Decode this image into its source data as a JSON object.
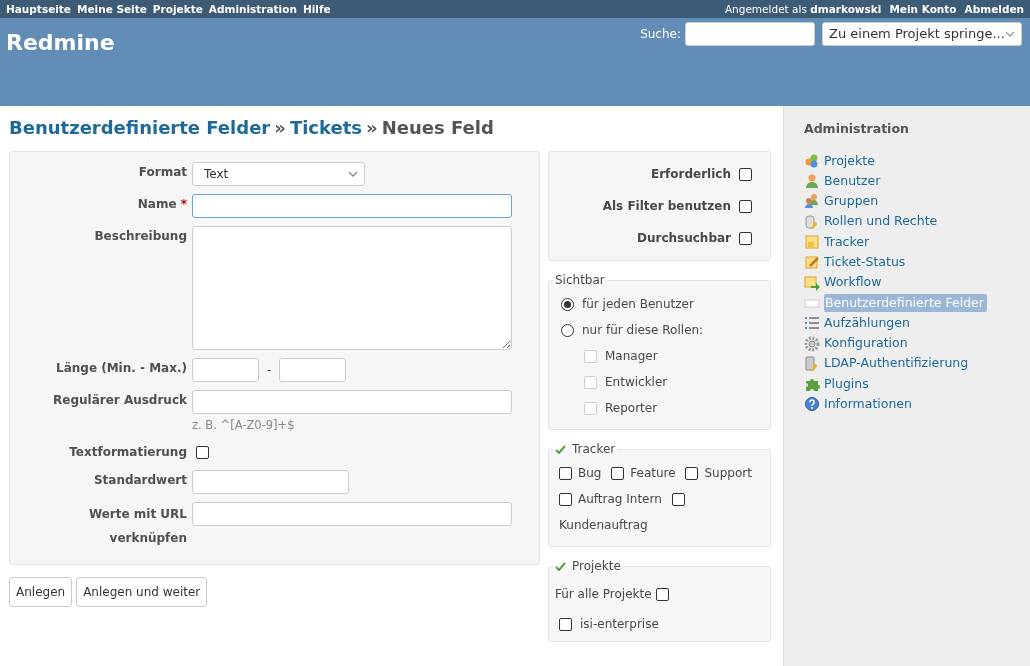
{
  "top_menu": {
    "links": [
      "Hauptseite",
      "Meine Seite",
      "Projekte",
      "Administration",
      "Hilfe"
    ],
    "logged_in_label": "Angemeldet als",
    "user": "dmarkowski",
    "account_links": [
      "Mein Konto",
      "Abmelden"
    ]
  },
  "header": {
    "title": "Redmine",
    "search_label": "Suche:",
    "jump": {
      "value": "Zu einem Projekt springe..."
    }
  },
  "breadcrumb": [
    {
      "text": "Benutzerdefinierte Felder",
      "kind": "link"
    },
    {
      "text": "»",
      "kind": "sep"
    },
    {
      "text": "Tickets",
      "kind": "link"
    },
    {
      "text": "»",
      "kind": "sep"
    },
    {
      "text": "Neues Feld",
      "kind": "current"
    }
  ],
  "form": {
    "fields": [
      {
        "label": "Format",
        "kind": "select",
        "value": "Text"
      },
      {
        "label": "Name",
        "kind": "text",
        "required": true,
        "required_mark": "*",
        "focused": true
      },
      {
        "label": "Beschreibung",
        "kind": "textarea"
      },
      {
        "label": "Länge (Min. - Max.)",
        "kind": "range",
        "separator": "-"
      },
      {
        "label": "Regulärer Ausdruck",
        "kind": "text",
        "hint": "z. B. ^[A-Z0-9]+$"
      },
      {
        "label": "Textformatierung",
        "kind": "checkbox",
        "checked": false
      },
      {
        "label": "Standardwert",
        "kind": "shorttext"
      },
      {
        "label": "Werte mit URL verknüpfen",
        "kind": "text"
      }
    ]
  },
  "flags": [
    {
      "label": "Erforderlich",
      "checked": false
    },
    {
      "label": "Als Filter benutzen",
      "checked": false
    },
    {
      "label": "Durchsuchbar",
      "checked": false
    }
  ],
  "visible": {
    "legend": "Sichtbar",
    "options": [
      {
        "label": "für jeden Benutzer",
        "selected": true
      },
      {
        "label": "nur für diese Rollen:",
        "selected": false
      }
    ],
    "roles": [
      {
        "label": "Manager",
        "checked": false,
        "disabled": true
      },
      {
        "label": "Entwickler",
        "checked": false,
        "disabled": true
      },
      {
        "label": "Reporter",
        "checked": false,
        "disabled": true
      }
    ]
  },
  "trackers": {
    "legend": "Tracker",
    "items": [
      {
        "label": "Bug",
        "checked": false
      },
      {
        "label": "Feature",
        "checked": false
      },
      {
        "label": "Support",
        "checked": false
      },
      {
        "label": "Auftrag Intern",
        "checked": false
      },
      {
        "label": "Kundenauftrag",
        "checked": false
      }
    ]
  },
  "projects": {
    "legend": "Projekte",
    "all_label": "Für alle Projekte",
    "all_checked": false,
    "items": [
      {
        "label": "isi-enterprise",
        "checked": false
      }
    ]
  },
  "buttons": [
    "Anlegen",
    "Anlegen und weiter"
  ],
  "sidebar": {
    "title": "Administration",
    "items": [
      {
        "label": "Projekte",
        "selected": false
      },
      {
        "label": "Benutzer",
        "selected": false
      },
      {
        "label": "Gruppen",
        "selected": false
      },
      {
        "label": "Rollen und Rechte",
        "selected": false
      },
      {
        "label": "Tracker",
        "selected": false
      },
      {
        "label": "Ticket-Status",
        "selected": false
      },
      {
        "label": "Workflow",
        "selected": false
      },
      {
        "label": "Benutzerdefinierte Felder",
        "selected": true
      },
      {
        "label": "Aufzählungen",
        "selected": false
      },
      {
        "label": "Konfiguration",
        "selected": false
      },
      {
        "label": "LDAP-Authentifizierung",
        "selected": false
      },
      {
        "label": "Plugins",
        "selected": false
      },
      {
        "label": "Informationen",
        "selected": false
      }
    ]
  }
}
